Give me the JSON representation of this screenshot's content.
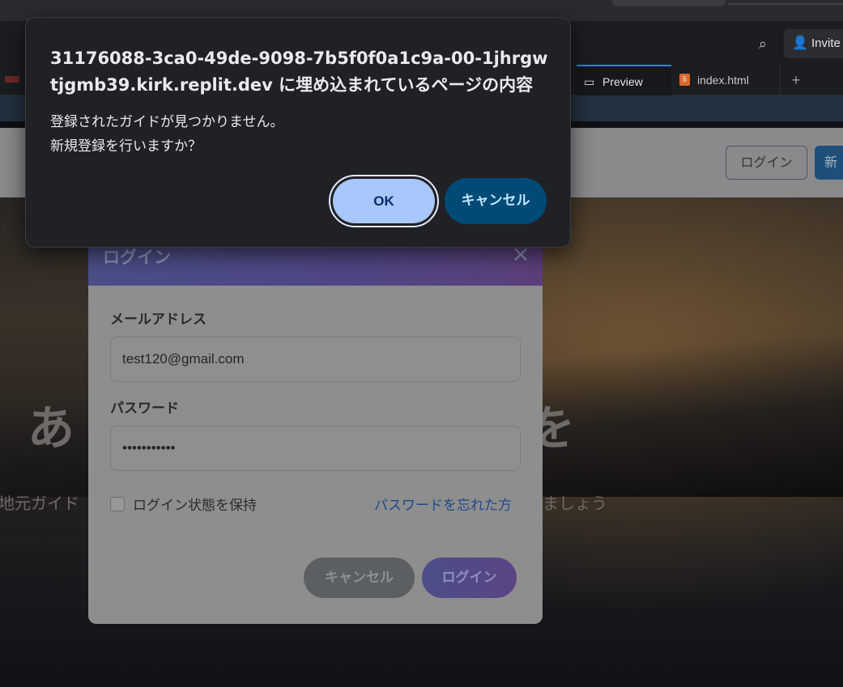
{
  "browser": {
    "invite_label": "Invite",
    "tabs": [
      {
        "label": "Preview",
        "icon": "monitor-icon"
      },
      {
        "label": "index.html",
        "icon": "html5-icon"
      }
    ],
    "add_tab_label": "+"
  },
  "site": {
    "nav": {
      "login_label": "ログイン",
      "register_label": "新"
    },
    "hero_title_start": "あ",
    "hero_title_end": "を",
    "hero_sub_start": "地元ガイド",
    "hero_sub_end": "ましょう"
  },
  "login_modal": {
    "title": "ログイン",
    "close_label": "×",
    "email_label": "メールアドレス",
    "email_value": "test120@gmail.com",
    "password_label": "パスワード",
    "password_value": "•••••••••••",
    "remember_label": "ログイン状態を保持",
    "forgot_label": "パスワードを忘れた方",
    "cancel_label": "キャンセル",
    "login_label": "ログイン"
  },
  "dialog": {
    "title": "31176088-3ca0-49de-9098-7b5f0f0a1c9a-00-1jhrgwtjgmb39.kirk.replit.dev に埋め込まれているページの内容",
    "message": "登録されたガイドが見つかりません。\n新規登録を行いますか？",
    "ok_label": "OK",
    "cancel_label": "キャンセル",
    "colors": {
      "ok_bg": "#a8c7fa",
      "cancel_bg": "#004a77",
      "surface": "#202124"
    }
  }
}
